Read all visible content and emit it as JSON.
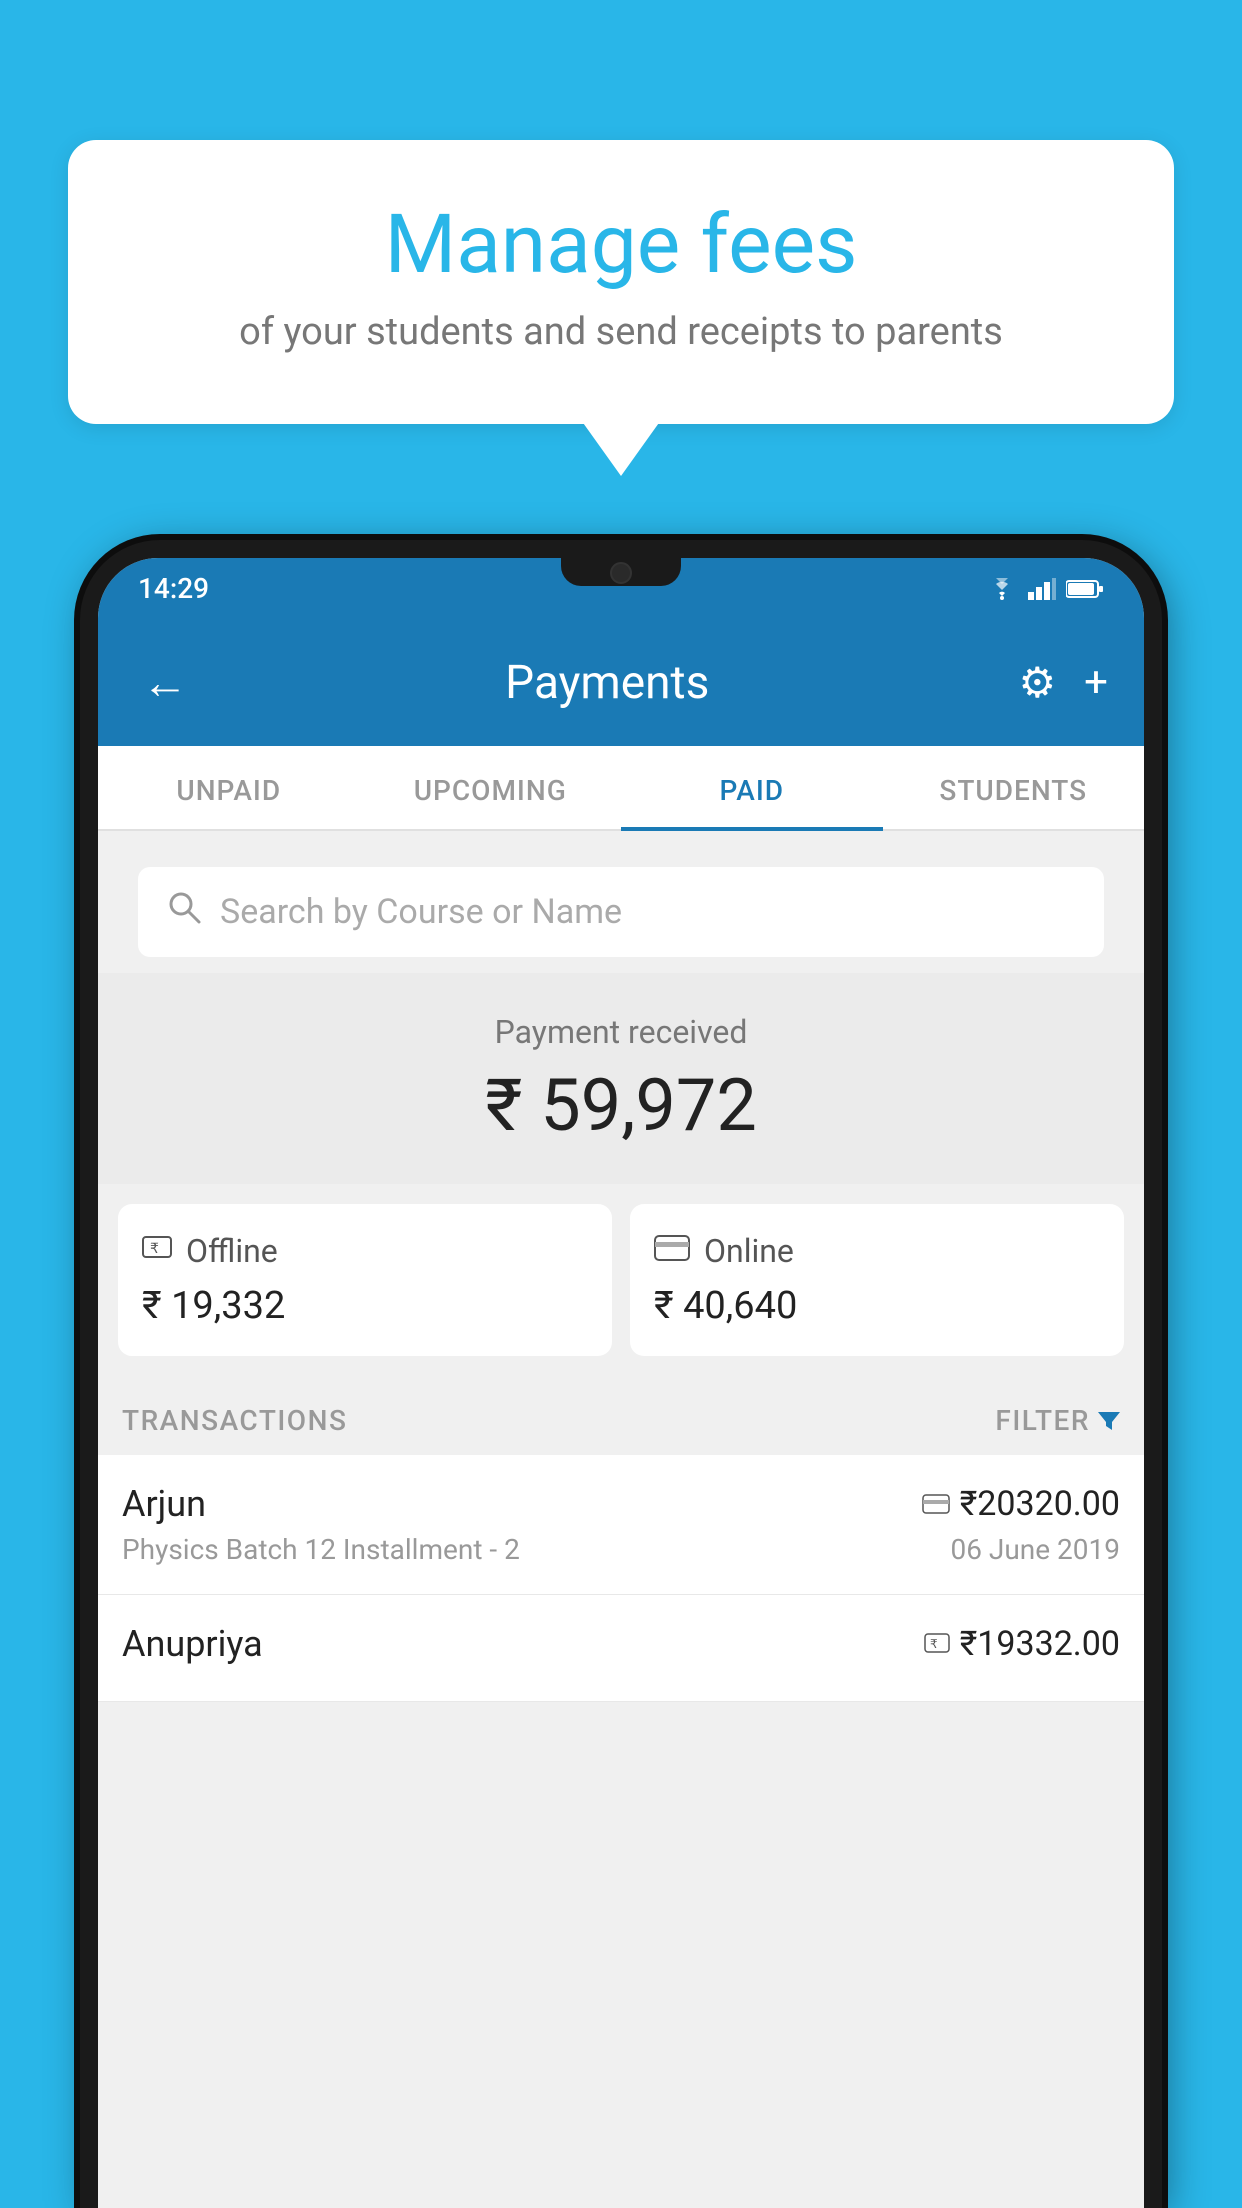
{
  "background_color": "#29b6e8",
  "bubble": {
    "title": "Manage fees",
    "subtitle": "of your students and send receipts to parents"
  },
  "status_bar": {
    "time": "14:29",
    "icons": [
      "wifi",
      "signal",
      "battery"
    ]
  },
  "app_bar": {
    "back_label": "←",
    "title": "Payments",
    "gear_label": "⚙",
    "plus_label": "+"
  },
  "tabs": [
    {
      "label": "UNPAID",
      "active": false
    },
    {
      "label": "UPCOMING",
      "active": false
    },
    {
      "label": "PAID",
      "active": true
    },
    {
      "label": "STUDENTS",
      "active": false
    }
  ],
  "search": {
    "placeholder": "Search by Course or Name"
  },
  "payment_received": {
    "label": "Payment received",
    "amount": "₹ 59,972"
  },
  "cards": [
    {
      "type": "Offline",
      "amount": "₹ 19,332",
      "icon": "rupee-card"
    },
    {
      "type": "Online",
      "amount": "₹ 40,640",
      "icon": "credit-card"
    }
  ],
  "transactions_label": "TRANSACTIONS",
  "filter_label": "FILTER",
  "transactions": [
    {
      "name": "Arjun",
      "detail": "Physics Batch 12 Installment - 2",
      "amount": "₹20320.00",
      "date": "06 June 2019",
      "payment_type": "card"
    },
    {
      "name": "Anupriya",
      "detail": "",
      "amount": "₹19332.00",
      "date": "",
      "payment_type": "rupee"
    }
  ]
}
